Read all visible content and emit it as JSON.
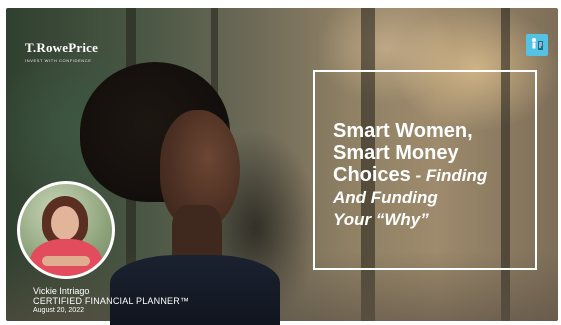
{
  "brand": {
    "name": "T.RowePrice",
    "tagline": "INVEST WITH CONFIDENCE"
  },
  "slide": {
    "title_line1": "Smart Women,",
    "title_line2": "Smart Money",
    "title_line3_bold": "Choices",
    "title_line3_sep": " - ",
    "title_line3_italic": "Finding",
    "title_line4": "And Funding",
    "title_line5": "Your “Why”"
  },
  "presenter": {
    "name": "Vickie Intriago",
    "credential": "CERTIFIED FINANCIAL PLANNER™",
    "date": "August 20, 2022"
  },
  "colors": {
    "badge": "#53c2e4",
    "text": "#ffffff"
  },
  "icons": {
    "badge": "accessibility-icon"
  }
}
